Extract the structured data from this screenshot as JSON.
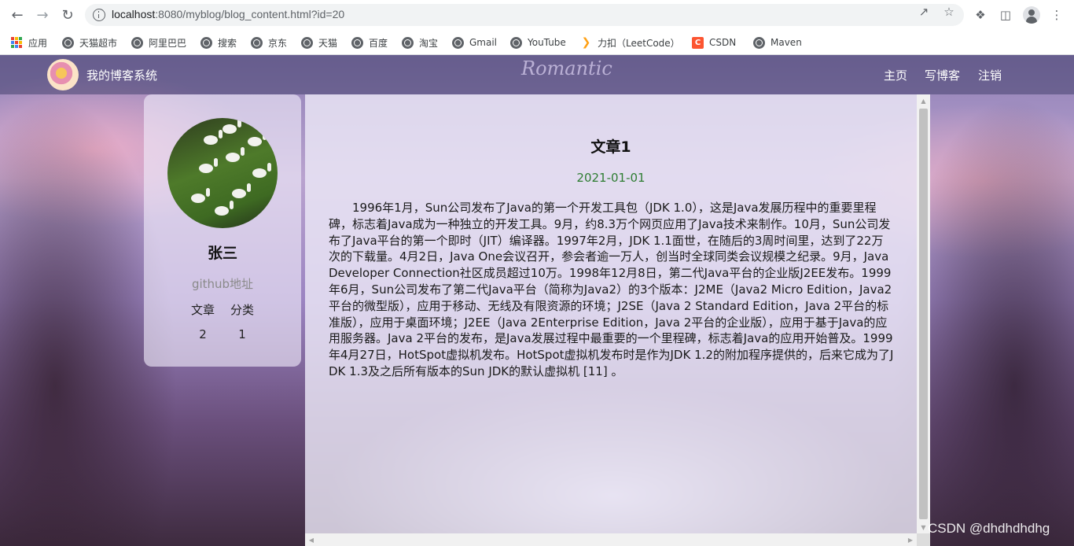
{
  "browser": {
    "url_host": "localhost",
    "url_rest": ":8080/myblog/blog_content.html?id=20",
    "bookmarks": [
      {
        "label": "应用",
        "icon": "apps-grid-icon"
      },
      {
        "label": "天猫超市",
        "icon": "globe-icon"
      },
      {
        "label": "阿里巴巴",
        "icon": "globe-icon"
      },
      {
        "label": "搜索",
        "icon": "globe-icon"
      },
      {
        "label": "京东",
        "icon": "globe-icon"
      },
      {
        "label": "天猫",
        "icon": "globe-icon"
      },
      {
        "label": "百度",
        "icon": "globe-icon"
      },
      {
        "label": "淘宝",
        "icon": "globe-icon"
      },
      {
        "label": "Gmail",
        "icon": "globe-icon"
      },
      {
        "label": "YouTube",
        "icon": "globe-icon"
      },
      {
        "label": "力扣（LeetCode）",
        "icon": "leetcode-icon"
      },
      {
        "label": "CSDN",
        "icon": "csdn-icon"
      },
      {
        "label": "Maven",
        "icon": "globe-icon"
      }
    ]
  },
  "nav": {
    "site_title": "我的博客系统",
    "banner_text": "Romantic",
    "links": [
      "主页",
      "写博客",
      "注销"
    ]
  },
  "user": {
    "name": "张三",
    "github": "github地址",
    "stat_labels": [
      "文章",
      "分类"
    ],
    "stat_values": [
      "2",
      "1"
    ]
  },
  "article": {
    "title": "文章1",
    "date": "2021-01-01",
    "body": "1996年1月，Sun公司发布了Java的第一个开发工具包（JDK 1.0），这是Java发展历程中的重要里程碑，标志着Java成为一种独立的开发工具。9月，约8.3万个网页应用了Java技术来制作。10月，Sun公司发布了Java平台的第一个即时（JIT）编译器。1997年2月，JDK 1.1面世，在随后的3周时间里，达到了22万次的下载量。4月2日，Java One会议召开，参会者逾一万人，创当时全球同类会议规模之纪录。9月，Java Developer Connection社区成员超过10万。1998年12月8日，第二代Java平台的企业版J2EE发布。1999年6月，Sun公司发布了第二代Java平台（简称为Java2）的3个版本：J2ME（Java2 Micro Edition，Java2平台的微型版），应用于移动、无线及有限资源的环境；J2SE（Java 2 Standard Edition，Java 2平台的标准版），应用于桌面环境；J2EE（Java 2Enterprise Edition，Java 2平台的企业版），应用于基于Java的应用服务器。Java 2平台的发布，是Java发展过程中最重要的一个里程碑，标志着Java的应用开始普及。1999年4月27日，HotSpot虚拟机发布。HotSpot虚拟机发布时是作为JDK 1.2的附加程序提供的，后来它成为了JDK 1.3及之后所有版本的Sun JDK的默认虚拟机 [11] 。"
  },
  "watermark": "CSDN @dhdhdhdhg",
  "colors": {
    "date_green": "#2e7d32",
    "nav_bg": "#46416e",
    "csdn_red": "#fc5531"
  }
}
